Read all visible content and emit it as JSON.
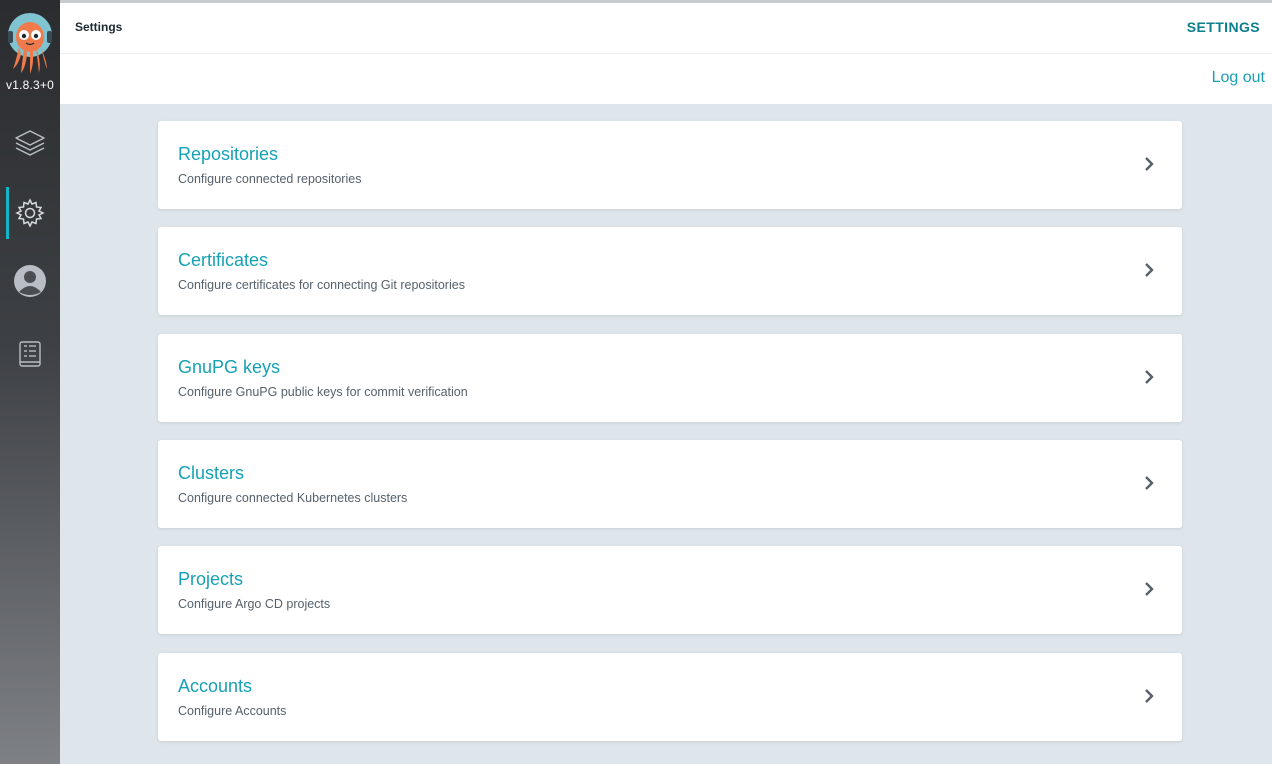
{
  "sidebar": {
    "version": "v1.8.3+0",
    "nav": [
      {
        "name": "applications",
        "icon": "layers-icon"
      },
      {
        "name": "settings",
        "icon": "gear-icon",
        "active": true
      },
      {
        "name": "user-info",
        "icon": "user-icon"
      },
      {
        "name": "documentation",
        "icon": "docs-icon"
      }
    ],
    "accent_color": "#14b4c8"
  },
  "topbar": {
    "title": "Settings",
    "right_label": "SETTINGS"
  },
  "subbar": {
    "logout_label": "Log out"
  },
  "settings_items": [
    {
      "title": "Repositories",
      "description": "Configure connected repositories"
    },
    {
      "title": "Certificates",
      "description": "Configure certificates for connecting Git repositories"
    },
    {
      "title": "GnuPG keys",
      "description": "Configure GnuPG public keys for commit verification"
    },
    {
      "title": "Clusters",
      "description": "Configure connected Kubernetes clusters"
    },
    {
      "title": "Projects",
      "description": "Configure Argo CD projects"
    },
    {
      "title": "Accounts",
      "description": "Configure Accounts"
    }
  ],
  "colors": {
    "link": "#16a1b5",
    "background": "#dee6eb"
  }
}
